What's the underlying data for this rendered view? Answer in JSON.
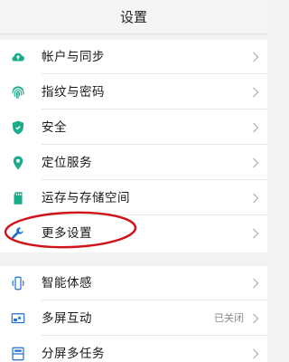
{
  "header": {
    "title": "设置"
  },
  "group1": {
    "items": [
      {
        "label": "帐户与同步",
        "icon": "cloud-sync-icon",
        "icon_color": "#1aab8a"
      },
      {
        "label": "指纹与密码",
        "icon": "fingerprint-icon",
        "icon_color": "#1aab8a"
      },
      {
        "label": "安全",
        "icon": "shield-icon",
        "icon_color": "#1aab8a"
      },
      {
        "label": "定位服务",
        "icon": "location-pin-icon",
        "icon_color": "#1aab8a"
      },
      {
        "label": "运存与存储空间",
        "icon": "sd-card-icon",
        "icon_color": "#1aab8a"
      },
      {
        "label": "更多设置",
        "icon": "wrench-icon",
        "icon_color": "#1f6fd1"
      }
    ]
  },
  "group2": {
    "items": [
      {
        "label": "智能体感",
        "icon": "phone-motion-icon",
        "icon_color": "#1f6fd1",
        "status": ""
      },
      {
        "label": "多屏互动",
        "icon": "screen-cast-icon",
        "icon_color": "#1f6fd1",
        "status": "已关闭"
      },
      {
        "label": "分屏多任务",
        "icon": "split-screen-icon",
        "icon_color": "#1f6fd1",
        "status": ""
      }
    ]
  },
  "annotation": {
    "color": "#d0121b"
  }
}
